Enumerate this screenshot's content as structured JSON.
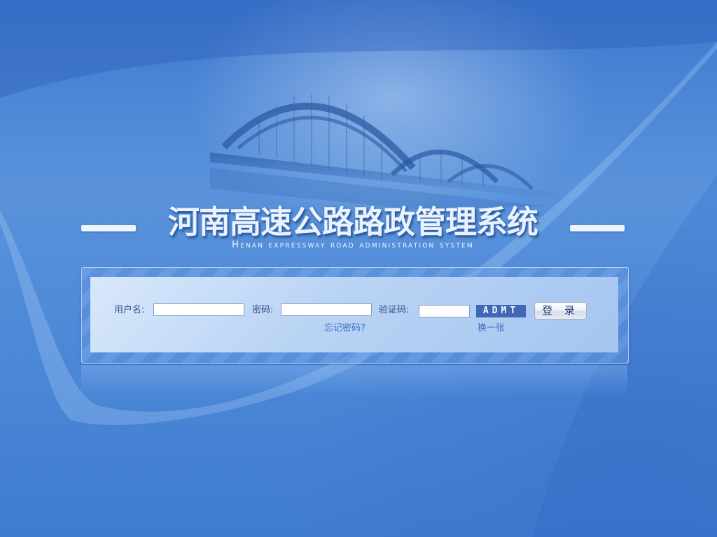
{
  "header": {
    "title": "河南高速公路路政管理系统",
    "subtitle": "Henan expressway road administration system"
  },
  "login_form": {
    "username_label": "用户名:",
    "password_label": "密码:",
    "captcha_label": "验证码:",
    "username_value": "",
    "password_value": "",
    "captcha_value": "",
    "captcha_text": "ADMT",
    "login_button": "登 录",
    "forgot_password_link": "忘记密码?",
    "refresh_captcha_link": "换一张"
  },
  "colors": {
    "background": "#4f8ad8",
    "panel": "#b9d3f4",
    "label_text": "#2d4f86",
    "link_text": "#3b6fc4",
    "captcha_bg": "#3f67b3"
  },
  "icons": [
    "bridge-illustration"
  ]
}
